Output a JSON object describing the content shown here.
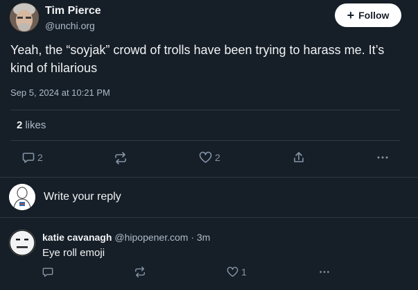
{
  "post": {
    "author": {
      "name": "Tim Pierce",
      "handle": "@unchi.org"
    },
    "follow_label": "Follow",
    "text": "Yeah, the “soyjak” crowd of trolls have been trying to harass me. It’s kind of hilarious",
    "timestamp": "Sep 5, 2024 at 10:21 PM",
    "likes_count": "2",
    "likes_label": "likes",
    "actions": {
      "reply_count": "2",
      "like_count": "2"
    }
  },
  "composer": {
    "prompt": "Write your reply"
  },
  "reply": {
    "author_name": "katie cavanagh",
    "author_meta": "@hipopener.com · 3m",
    "text": "Eye roll emoji",
    "actions": {
      "like_count": "1"
    }
  },
  "colors": {
    "background": "#161e27",
    "divider": "#2e3a48",
    "text_primary": "#f1f3f5",
    "text_secondary": "#aebbc9",
    "icon": "#8596a8",
    "follow_button_bg": "#ffffff"
  }
}
